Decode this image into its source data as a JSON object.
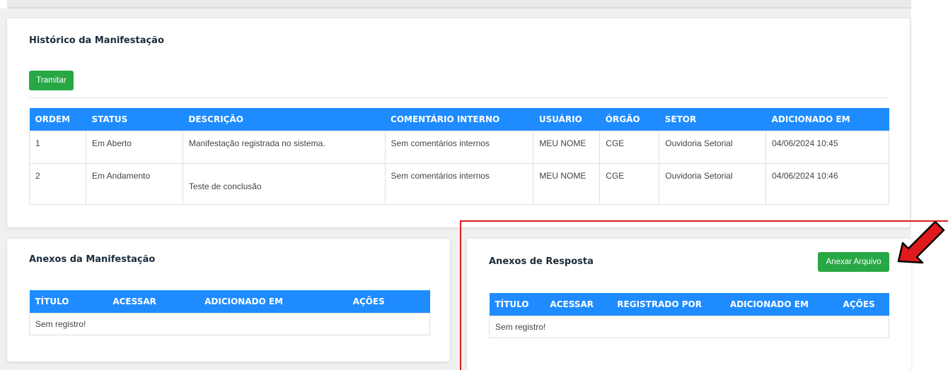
{
  "historico": {
    "title": "Histórico da Manifestação",
    "tramitar_label": "Tramitar",
    "columns": [
      "ORDEM",
      "STATUS",
      "DESCRIÇÃO",
      "COMENTÁRIO INTERNO",
      "USUÁRIO",
      "ÓRGÃO",
      "SETOR",
      "ADICIONADO EM"
    ],
    "rows": [
      [
        "1",
        "Em Aberto",
        "Manifestação registrada no sistema.",
        "Sem comentários internos",
        "MEU NOME",
        "CGE",
        "Ouvidoria Setorial",
        "04/06/2024 10:45"
      ],
      [
        "2",
        "Em Andamento",
        "Teste de conclusão",
        "Sem comentários internos",
        "MEU NOME",
        "CGE",
        "Ouvidoria Setorial",
        "04/06/2024 10:46"
      ]
    ]
  },
  "anexos_manifestacao": {
    "title": "Anexos da Manifestação",
    "columns": [
      "TÍTULO",
      "ACESSAR",
      "ADICIONADO EM",
      "AÇÕES"
    ],
    "empty_text": "Sem registro!"
  },
  "anexos_resposta": {
    "title": "Anexos de Resposta",
    "anexar_label": "Anexar Arquivo",
    "columns": [
      "TÍTULO",
      "ACESSAR",
      "REGISTRADO POR",
      "ADICIONADO EM",
      "AÇÕES"
    ],
    "empty_text": "Sem registro!"
  },
  "colors": {
    "table_header": "#1e8cff",
    "button_green": "#28a745",
    "annotation_red": "#e01a1a"
  },
  "annotation": {
    "icon": "red-arrow-icon"
  }
}
